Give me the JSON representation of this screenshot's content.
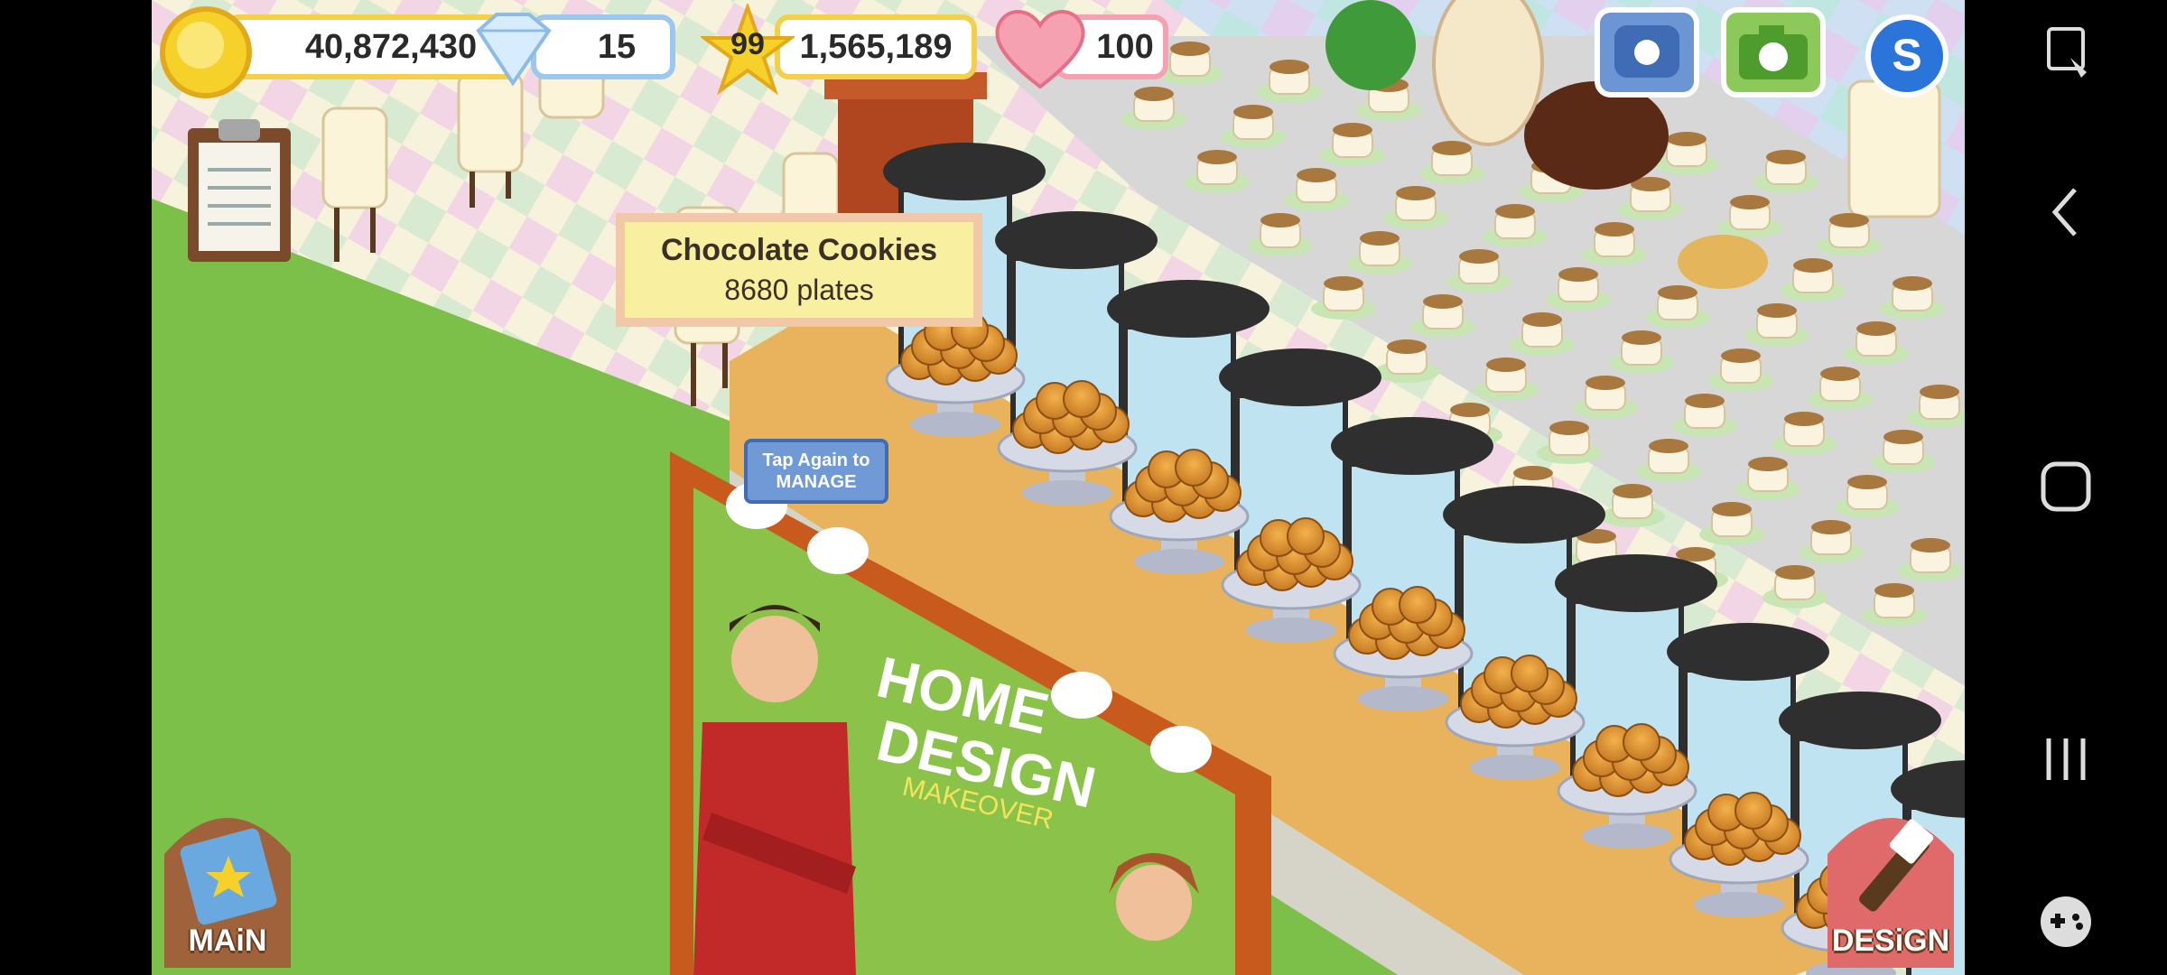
{
  "hud": {
    "coins": "40,872,430",
    "gems": "15",
    "level": "99",
    "xp": "1,565,189",
    "hearts": "100"
  },
  "tooltip": {
    "item_name": "Chocolate Cookies",
    "amount": "8680 plates"
  },
  "manage_hint": {
    "line1": "Tap Again to",
    "line2": "MANAGE"
  },
  "buttons": {
    "main": "MAiN",
    "design": "DESiGN"
  },
  "billboard": {
    "line1": "HOME",
    "line2": "DESIGN",
    "line3": "MAKEOVER"
  },
  "icons": {
    "coins": "coin-icon",
    "gems": "diamond-icon",
    "level": "star-icon",
    "hearts": "heart-icon",
    "phone": "phone-icon",
    "camera": "camera-icon",
    "social": "social-s-icon",
    "clipboard": "clipboard-icon",
    "nav": [
      "screen-rotate-icon",
      "back-icon",
      "home-icon",
      "recents-icon",
      "game-controller-icon"
    ]
  },
  "colors": {
    "grass": "#7cc04a",
    "counter": "#e9b25c",
    "coin_border": "#f4d04a",
    "gem_border": "#9cc8ef",
    "heart_border": "#f6a1b2",
    "tooltip_bg": "#f8efa0"
  }
}
